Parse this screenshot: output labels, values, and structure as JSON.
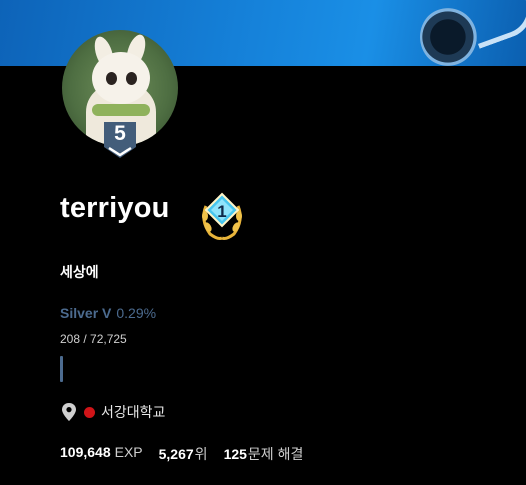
{
  "profile": {
    "avatar_tier_number": "5",
    "username": "terriyou",
    "rank_badge_number": "1",
    "bio": "세상에",
    "tier_name": "Silver V",
    "tier_percent": "0.29%",
    "rating_progress": "208 / 72,725",
    "organization": "서강대학교",
    "stats": {
      "exp_value": "109,648",
      "exp_unit": "EXP",
      "rank_value": "5,267",
      "rank_unit": "위",
      "solved_value": "125",
      "solved_unit": "문제 해결"
    }
  },
  "colors": {
    "tier_color": "#4c6b8f",
    "org_dot": "#d01418",
    "banner": "#1580d8"
  },
  "icons": [
    "tier-shield-icon",
    "rank-laurel-icon",
    "location-pin-icon"
  ]
}
